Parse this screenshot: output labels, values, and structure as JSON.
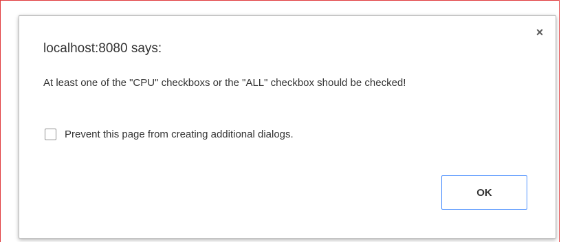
{
  "dialog": {
    "title": "localhost:8080 says:",
    "message": "At least one of the \"CPU\" checkboxs or the \"ALL\"  checkbox should be checked!",
    "prevent_checkbox": {
      "label": "Prevent this page from creating additional dialogs.",
      "checked": false
    },
    "ok_label": "OK",
    "close_glyph": "×",
    "close_icon": "close-icon"
  },
  "colors": {
    "frame_border": "#e0393b",
    "ok_border": "#4d90fe",
    "text": "#333333"
  }
}
